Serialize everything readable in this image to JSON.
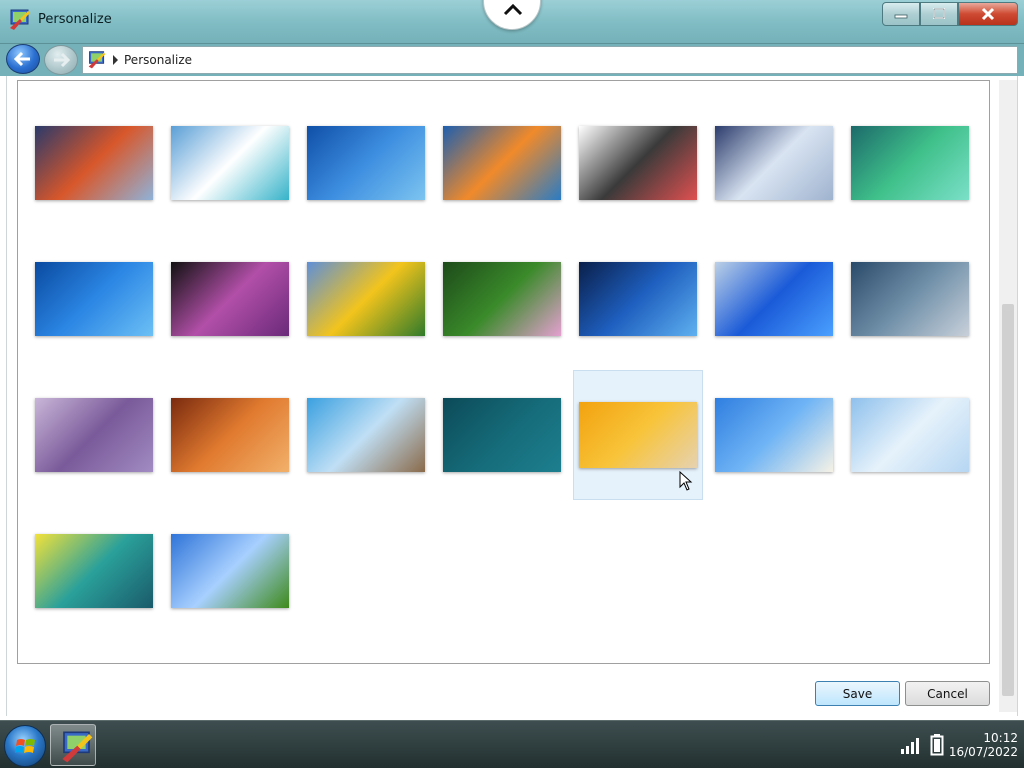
{
  "window": {
    "title": "Personalize",
    "buttons": {
      "minimize": "minimize",
      "maximize": "maximize",
      "close": "close"
    }
  },
  "nav": {
    "breadcrumb": "Personalize"
  },
  "wallpapers": [
    {
      "id": "w1",
      "colors": [
        "#2a3a6a",
        "#d8572a",
        "#8fb2d8"
      ]
    },
    {
      "id": "w2",
      "colors": [
        "#5a9fd6",
        "#ffffff",
        "#36b3c9"
      ]
    },
    {
      "id": "w3",
      "colors": [
        "#0f4fa8",
        "#3d8ee0",
        "#7cc4f0"
      ]
    },
    {
      "id": "w4",
      "colors": [
        "#1d5fae",
        "#f08a2a",
        "#2a7cc4"
      ]
    },
    {
      "id": "w5",
      "colors": [
        "#ffffff",
        "#3a3a3a",
        "#e05050"
      ]
    },
    {
      "id": "w6",
      "colors": [
        "#2c3c6c",
        "#d9e4f2",
        "#9fb3cf"
      ]
    },
    {
      "id": "w7",
      "colors": [
        "#1c6a6a",
        "#3fc08a",
        "#7be0c8"
      ]
    },
    {
      "id": "w8",
      "colors": [
        "#0a4aa0",
        "#2b86e4",
        "#6cc0f5"
      ]
    },
    {
      "id": "w9",
      "colors": [
        "#111111",
        "#b24fa8",
        "#6a2a7a"
      ]
    },
    {
      "id": "w10",
      "colors": [
        "#5f8fd8",
        "#f2c41c",
        "#2f7a2a"
      ]
    },
    {
      "id": "w11",
      "colors": [
        "#1d4a1a",
        "#3a8a2a",
        "#e4a0d0"
      ]
    },
    {
      "id": "w12",
      "colors": [
        "#0a1f4a",
        "#1e5fbf",
        "#5fb0f0"
      ]
    },
    {
      "id": "w13",
      "colors": [
        "#bcd0e6",
        "#1a5ad8",
        "#4aa0ff"
      ]
    },
    {
      "id": "w14",
      "colors": [
        "#2a4a6a",
        "#6f8fa8",
        "#c8d0da"
      ]
    },
    {
      "id": "w15",
      "colors": [
        "#c9b6d8",
        "#7a5a9a",
        "#a18bc2"
      ]
    },
    {
      "id": "w16",
      "colors": [
        "#7a2a0f",
        "#e07a2f",
        "#f2b06a"
      ]
    },
    {
      "id": "w17",
      "colors": [
        "#3aa0e0",
        "#c0dff5",
        "#8a6a4a"
      ]
    },
    {
      "id": "w18",
      "colors": [
        "#0c4a58",
        "#156a78",
        "#1d7f8e"
      ]
    },
    {
      "id": "w19",
      "colors": [
        "#f2a20f",
        "#f8c43a",
        "#e6d2b0"
      ]
    },
    {
      "id": "w20",
      "colors": [
        "#2f7ee0",
        "#6fb4f5",
        "#f6f2e6"
      ]
    },
    {
      "id": "w21",
      "colors": [
        "#8ec0ec",
        "#e6f2fb",
        "#b6d6f2"
      ]
    },
    {
      "id": "w22",
      "colors": [
        "#f2e23a",
        "#2aa09a",
        "#1a5a6a"
      ]
    },
    {
      "id": "w23",
      "colors": [
        "#2f74d8",
        "#a8d0ff",
        "#3e8a1a"
      ]
    }
  ],
  "selected_wallpaper": "w19",
  "actions": {
    "save_label": "Save",
    "cancel_label": "Cancel"
  },
  "taskbar": {
    "time": "10:12",
    "date": "16/07/2022"
  }
}
